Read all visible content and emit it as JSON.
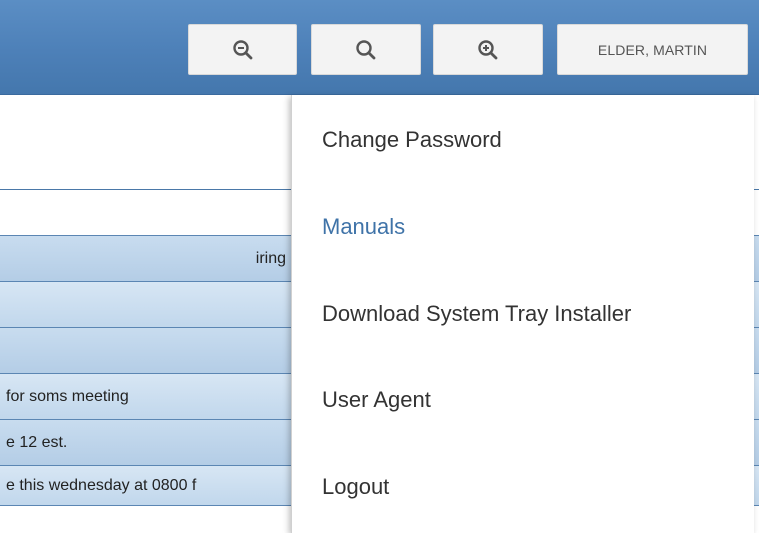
{
  "toolbar": {
    "zoom_out_icon": "zoom-out-icon",
    "search_icon": "search-icon",
    "zoom_in_icon": "zoom-in-icon",
    "user_label": "ELDER, MARTIN"
  },
  "table": {
    "rows": [
      {
        "text": "iring"
      },
      {
        "text": ""
      },
      {
        "text": ""
      },
      {
        "text": " for soms meeting"
      },
      {
        "text": "e 12 est."
      },
      {
        "text": "e this wednesday at 0800 f"
      }
    ]
  },
  "user_menu": {
    "items": [
      {
        "label": "Change Password"
      },
      {
        "label": "Manuals"
      },
      {
        "label": "Download System Tray Installer"
      },
      {
        "label": "User Agent"
      },
      {
        "label": "Logout"
      }
    ]
  },
  "colors": {
    "topbar": "#4d80b8",
    "menu_link": "#3f73a8",
    "row_fill": "#c1d7ec"
  }
}
